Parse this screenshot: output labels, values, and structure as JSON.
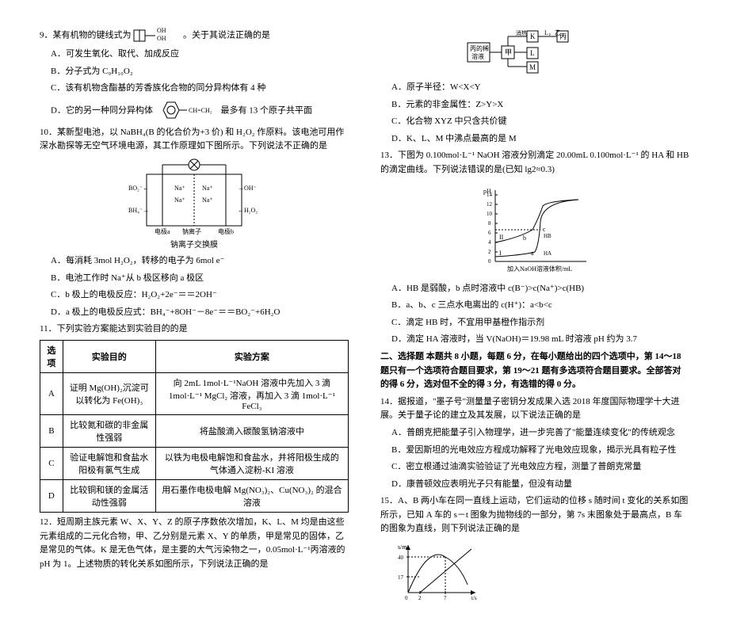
{
  "left": {
    "q9_intro1": "9．某有机物的键线式为",
    "q9_intro2": "。关于其说法正确的是",
    "q9_A": "A．可发生氧化、取代、加成反应",
    "q9_B": "B．分子式为 C₉H₁₀O₂",
    "q9_C": "C．该有机物含酯基的芳香族化合物的同分异构体有 4 种",
    "q9_D1": "D．它的另一种同分异构体",
    "q9_D2": "最多有 13 个原子共平面",
    "q10": "10．某新型电池，以 NaBH₄(B 的化合价为+3 价) 和 H₂O₂ 作原料。该电池可用作深水勘探等无空气环境电源，其工作原理如下图所示。下列说法不正确的是",
    "q10_A": "A．每消耗 3mol H₂O₂，转移的电子为 6mol e⁻",
    "q10_B": "B．电池工作时 Na⁺从 b 极区移向 a 极区",
    "q10_C": "C．b 极上的电极反应：H₂O₂+2e⁻＝＝2OH⁻",
    "q10_D": "D．a 极上的电极反应式：BH₄⁻+8OH⁻－8e⁻＝＝BO₂⁻+6H₂O",
    "q11": "11．下列实验方案能达到实验目的的是",
    "t_h1": "选项",
    "t_h2": "实验目的",
    "t_h3": "实验方案",
    "t_A1": "A",
    "t_A2": "证明 Mg(OH)₂沉淀可以转化为 Fe(OH)₃",
    "t_A3": "向 2mL 1mol·L⁻¹NaOH 溶液中先加入 3 滴 1mol·L⁻¹ MgCl₂ 溶液，再加入 3 滴 1mol·L⁻¹ FeCl₃",
    "t_B1": "B",
    "t_B2": "比较氮和碳的非金属性强弱",
    "t_B3": "将盐酸滴入碳酸氢钠溶液中",
    "t_C1": "C",
    "t_C2": "验证电解饱和食盐水阳极有氯气生成",
    "t_C3": "以铁为电极电解饱和食盐水，并将阳极生成的气体通入淀粉-KI 溶液",
    "t_D1": "D",
    "t_D2": "比较铜和镁的金属活动性强弱",
    "t_D3": "用石墨作电极电解 Mg(NO₃)₂、Cu(NO₃)₂ 的混合溶液",
    "q12": "12．短周期主族元素 W、X、Y、Z 的原子序数依次增加，K、L、M 均是由这些元素组成的二元化合物，甲、乙分别是元素 X、Y 的单质，甲是常见的固体，乙是常见的气体。K 是无色气体，是主要的大气污染物之一，0.05mol·L⁻¹丙溶液的 pH 为 1。上述物质的转化关系如图所示，下列说法正确的是"
  },
  "right": {
    "q12_A": "A．原子半径：W<X<Y",
    "q12_B": "B．元素的非金属性：Z>Y>X",
    "q12_C": "C．化合物 XYZ 中只含共价键",
    "q12_D": "D．K、L、M 中沸点最高的是 M",
    "q13": "13．下图为 0.100mol·L⁻¹ NaOH 溶液分别滴定 20.00mL 0.100mol·L⁻¹ 的 HA 和 HB 的滴定曲线。下列说法错误的是(已知 lg2≈0.3)",
    "q13_A": "A．HB 是弱酸，b 点时溶液中 c(B⁻)>c(Na⁺)>c(HB)",
    "q13_B": "B．a、b、c 三点水电离出的 c(H⁺)：a<b<c",
    "q13_C": "C．滴定 HB 时，不宜用甲基橙作指示剂",
    "q13_D": "D．滴定 HA 溶液时，当 V(NaOH)＝19.98 mL 时溶液 pH 约为 3.7",
    "head2": "二、选择题 本题共 8 小题，每题 6 分，在每小题给出的四个选项中，第 14～18 题只有一个选项符合题目要求，第 19～21 题有多选项符合题目要求。全部答对的得 6 分，选对但不全的得 3 分，有选错的得 0 分。",
    "q14": "14．据报道，\"墨子号\"测量量子密钥分发成果入选 2018 年度国际物理学十大进展。关于量子论的建立及其发展，以下说法正确的是",
    "q14_A": "A．普朗克把能量子引入物理学，进一步完善了\"能量连续变化\"的传统观念",
    "q14_B": "B．爱因斯坦的光电效应方程成功解释了光电效应现象，揭示光具有粒子性",
    "q14_C": "C．密立根通过油滴实验验证了光电效应方程，测量了普朗克常量",
    "q14_D": "D．康普顿效应表明光子只有能量，但没有动量",
    "q15": "15．A、B 两小车在同一直线上运动，它们运动的位移 s 随时间 t 变化的关系如图所示，已知 A 车的 s－t 图象为抛物线的一部分，第 7s 末图象处于最高点，B 车的图象为直线，则下列说法正确的是"
  },
  "chart_data": [
    {
      "type": "line",
      "title": "滴定曲线",
      "xlabel": "加入NaOH溶液体积/mL",
      "ylabel": "pH",
      "xlim": [
        0,
        40
      ],
      "ylim": [
        0,
        14
      ],
      "series": [
        {
          "name": "HA",
          "x": [
            0,
            10,
            18,
            20,
            22,
            40
          ],
          "y": [
            1,
            1.5,
            3,
            7,
            11,
            12.5
          ]
        },
        {
          "name": "HB",
          "x": [
            0,
            10,
            18,
            20,
            22,
            40
          ],
          "y": [
            4,
            5,
            7,
            9,
            11.5,
            12.5
          ]
        }
      ],
      "annotations": [
        "I",
        "II",
        "a",
        "b",
        "c"
      ]
    },
    {
      "type": "line",
      "title": "s-t 图",
      "xlabel": "t/s",
      "ylabel": "s/m",
      "xlim": [
        0,
        10
      ],
      "ylim": [
        0,
        50
      ],
      "series": [
        {
          "name": "A",
          "x": [
            0,
            2,
            4,
            7,
            10
          ],
          "y": [
            0,
            17,
            30,
            40,
            30
          ]
        },
        {
          "name": "B",
          "x": [
            2,
            10
          ],
          "y": [
            0,
            50
          ]
        }
      ],
      "annotations": [
        "40",
        "17",
        "2",
        "7"
      ]
    }
  ]
}
